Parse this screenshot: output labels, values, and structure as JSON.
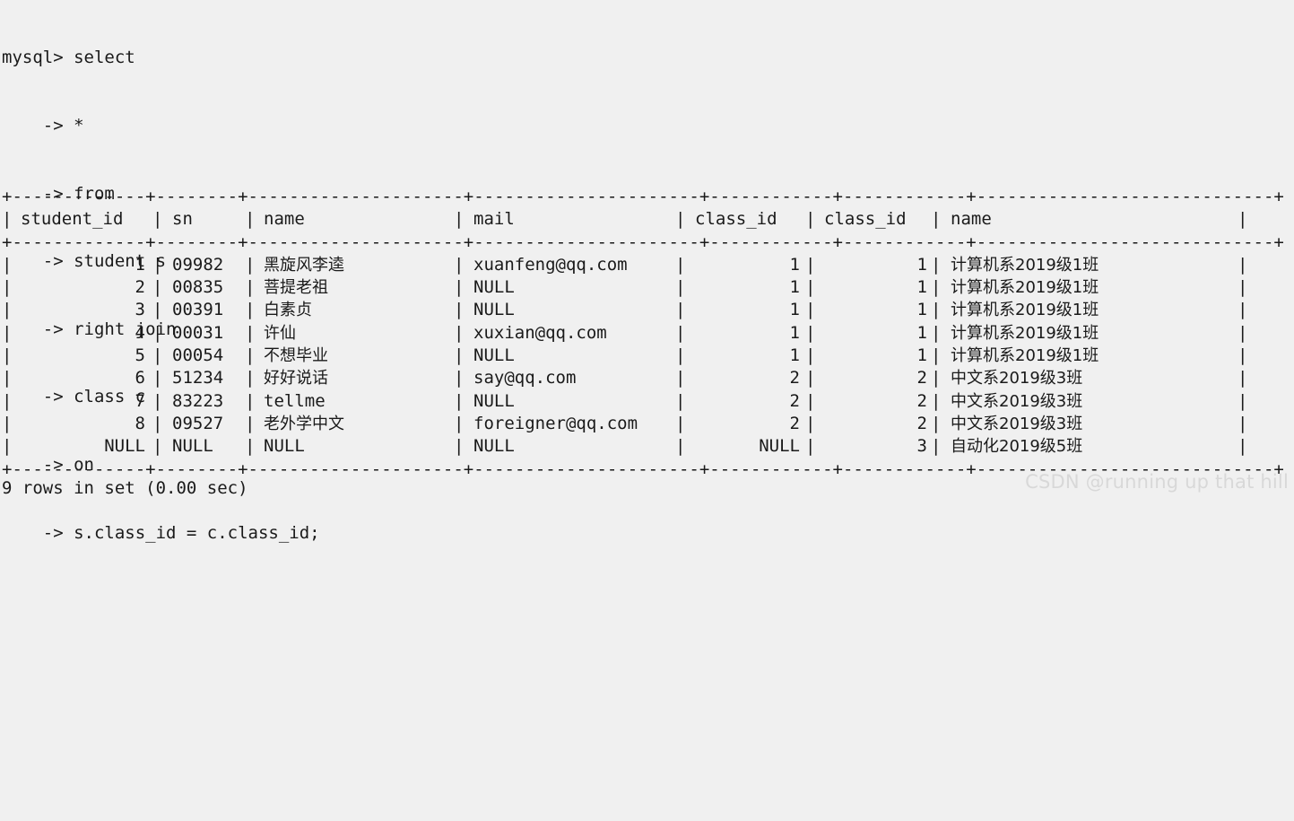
{
  "terminal": {
    "background_color": "#f0f0f0",
    "text_color": "#1a1a1a",
    "prompt": "mysql>",
    "continuation": "->"
  },
  "query": {
    "lines": [
      "mysql> select",
      "    -> *",
      "    -> from",
      "    -> student s",
      "    -> right join",
      "    -> class c",
      "    -> on",
      "    -> s.class_id = c.class_id;"
    ]
  },
  "result_table": {
    "border_top": "+-------------+--------+---------------------+----------------------+------------+------------+-----------------------------+",
    "border_header": "+-------------+--------+---------------------+----------------------+------------+------------+-----------------------------+",
    "border_bottom": "+-------------+--------+---------------------+----------------------+------------+------------+-----------------------------+",
    "headers": [
      "student_id",
      "sn",
      "name",
      "mail",
      "class_id",
      "class_id",
      "name"
    ],
    "rows": [
      {
        "student_id": "1",
        "sn": "09982",
        "name": "黑旋风李逵",
        "mail": "xuanfeng@qq.com",
        "s_class_id": "1",
        "c_class_id": "1",
        "class_name": "计算机系2019级1班"
      },
      {
        "student_id": "2",
        "sn": "00835",
        "name": "菩提老祖",
        "mail": "NULL",
        "s_class_id": "1",
        "c_class_id": "1",
        "class_name": "计算机系2019级1班"
      },
      {
        "student_id": "3",
        "sn": "00391",
        "name": "白素贞",
        "mail": "NULL",
        "s_class_id": "1",
        "c_class_id": "1",
        "class_name": "计算机系2019级1班"
      },
      {
        "student_id": "4",
        "sn": "00031",
        "name": "许仙",
        "mail": "xuxian@qq.com",
        "s_class_id": "1",
        "c_class_id": "1",
        "class_name": "计算机系2019级1班"
      },
      {
        "student_id": "5",
        "sn": "00054",
        "name": "不想毕业",
        "mail": "NULL",
        "s_class_id": "1",
        "c_class_id": "1",
        "class_name": "计算机系2019级1班"
      },
      {
        "student_id": "6",
        "sn": "51234",
        "name": "好好说话",
        "mail": "say@qq.com",
        "s_class_id": "2",
        "c_class_id": "2",
        "class_name": "中文系2019级3班"
      },
      {
        "student_id": "7",
        "sn": "83223",
        "name": "tellme",
        "mail": "NULL",
        "s_class_id": "2",
        "c_class_id": "2",
        "class_name": "中文系2019级3班"
      },
      {
        "student_id": "8",
        "sn": "09527",
        "name": "老外学中文",
        "mail": "foreigner@qq.com",
        "s_class_id": "2",
        "c_class_id": "2",
        "class_name": "中文系2019级3班"
      },
      {
        "student_id": "NULL",
        "sn": "NULL",
        "name": "NULL",
        "mail": "NULL",
        "s_class_id": "NULL",
        "c_class_id": "3",
        "class_name": "自动化2019级5班"
      }
    ]
  },
  "status": {
    "text": "9 rows in set (0.00 sec)",
    "row_count": 9,
    "duration": "0.00 sec"
  },
  "watermark": {
    "text": "CSDN @running up that hill",
    "color": "#d8d8d8"
  }
}
